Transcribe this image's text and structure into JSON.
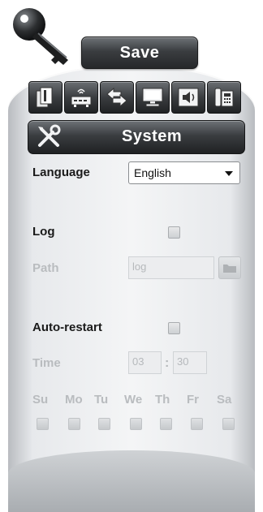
{
  "toolbar": {
    "save_label": "Save",
    "tools": [
      {
        "icon": "documents-icon"
      },
      {
        "icon": "router-icon"
      },
      {
        "icon": "transfer-arrows-icon"
      },
      {
        "icon": "monitor-icon"
      },
      {
        "icon": "speaker-icon"
      },
      {
        "icon": "phone-icon"
      }
    ]
  },
  "section": {
    "title": "System",
    "icon": "tools-icon"
  },
  "language": {
    "label": "Language",
    "selected": "English"
  },
  "log": {
    "label": "Log",
    "checked": false,
    "path_label": "Path",
    "path_value": "log"
  },
  "auto_restart": {
    "label": "Auto-restart",
    "checked": false,
    "time_label": "Time",
    "hour": "03",
    "minute": "30",
    "separator": ":",
    "days": [
      "Su",
      "Mo",
      "Tu",
      "We",
      "Th",
      "Fr",
      "Sa"
    ]
  },
  "colors": {
    "button_dark": "#2a2c2e",
    "panel_light": "#f2f3f4",
    "disabled_text": "#b9bcbf"
  }
}
